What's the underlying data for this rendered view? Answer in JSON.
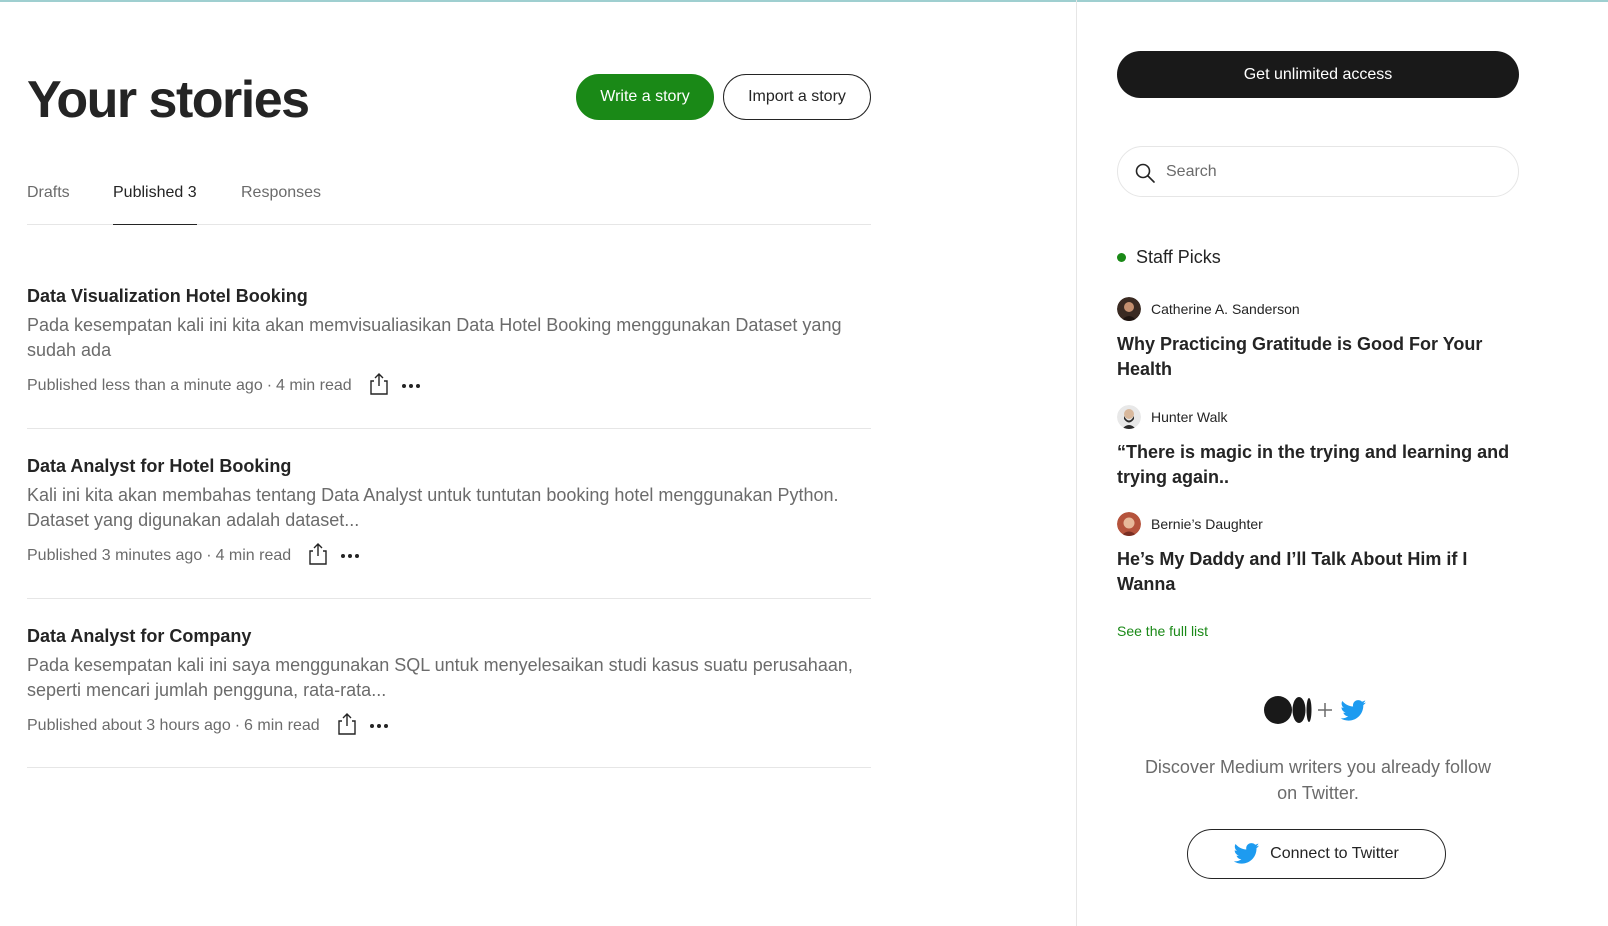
{
  "header": {
    "title": "Your stories",
    "write_label": "Write a story",
    "import_label": "Import a story"
  },
  "tabs": [
    {
      "label": "Drafts",
      "active": false
    },
    {
      "label": "Published 3",
      "active": true
    },
    {
      "label": "Responses",
      "active": false
    }
  ],
  "stories": [
    {
      "title": "Data Visualization Hotel Booking",
      "description": "Pada kesempatan kali ini kita akan memvisualiasikan Data Hotel Booking menggunakan Dataset yang sudah ada",
      "published": "Published less than a minute ago",
      "sep": "·",
      "read_time": "4 min read"
    },
    {
      "title": "Data Analyst for Hotel Booking",
      "description": "Kali ini kita akan membahas tentang Data Analyst untuk tuntutan booking hotel menggunakan Python. Dataset yang digunakan adalah dataset...",
      "published": "Published 3 minutes ago",
      "sep": "·",
      "read_time": "4 min read"
    },
    {
      "title": "Data Analyst for Company",
      "description": "Pada kesempatan kali ini saya menggunakan SQL untuk menyelesaikan studi kasus suatu perusahaan, seperti mencari jumlah pengguna, rata-rata...",
      "published": "Published about 3 hours ago",
      "sep": "·",
      "read_time": "6 min read"
    }
  ],
  "sidebar": {
    "access_label": "Get unlimited access",
    "search_placeholder": "Search",
    "staff_picks_label": "Staff Picks",
    "picks": [
      {
        "author": "Catherine A. Sanderson",
        "title": "Why Practicing Gratitude is Good For Your Health",
        "avatar_color": "#3a2a22"
      },
      {
        "author": "Hunter Walk",
        "title": "“There is magic in the trying and learning and trying again..",
        "avatar_color": "#d9d9d9"
      },
      {
        "author": "Bernie’s Daughter",
        "title": "He’s My Daddy and I’ll Talk About Him if I Wanna",
        "avatar_color": "#b5533c"
      }
    ],
    "see_list_label": "See the full list",
    "discover_text": "Discover Medium writers you already follow on Twitter.",
    "twitter_label": "Connect to Twitter"
  },
  "colors": {
    "accent_green": "#1a8917",
    "twitter_blue": "#1d9bf0",
    "text_dark": "#242424",
    "text_muted": "#6b6b6b"
  },
  "icons": [
    "share-icon",
    "more-icon",
    "search-icon",
    "medium-logo-icon",
    "plus-icon",
    "twitter-icon"
  ]
}
